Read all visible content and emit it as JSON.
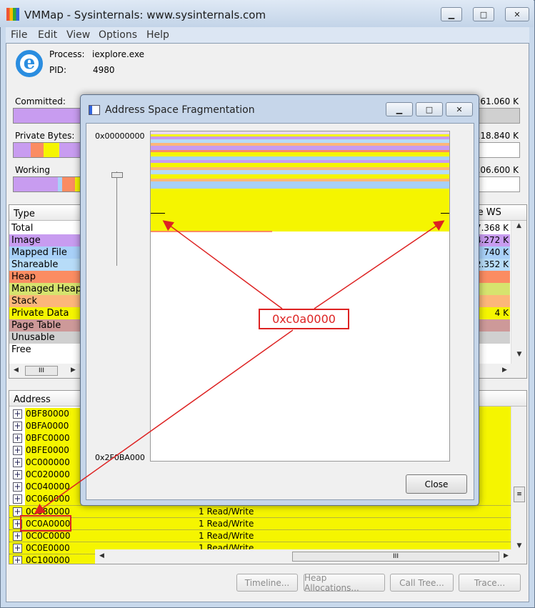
{
  "window": {
    "title": "VMMap - Sysinternals: www.sysinternals.com"
  },
  "menu": [
    "File",
    "Edit",
    "View",
    "Options",
    "Help"
  ],
  "process": {
    "process_label": "Process:",
    "process_value": "iexplore.exe",
    "pid_label": "PID:",
    "pid_value": "4980"
  },
  "summary": {
    "committed": {
      "label": "Committed:",
      "value": "261.060 K"
    },
    "private": {
      "label": "Private Bytes:",
      "value": "118.840 K"
    },
    "working": {
      "label": "Working",
      "value": "106.600 K"
    }
  },
  "type_table": {
    "header_type": "Type",
    "header_ws": "le WS",
    "rows": [
      {
        "type": "Total",
        "color": "#ffffff",
        "ws": "7.368 K"
      },
      {
        "type": "Image",
        "color": "#c89cf0",
        "ws": "4.272 K"
      },
      {
        "type": "Mapped File",
        "color": "#a8d0f8",
        "ws": "740 K"
      },
      {
        "type": "Shareable",
        "color": "#b7dcf8",
        "ws": "2.352 K"
      },
      {
        "type": "Heap",
        "color": "#fb8c62",
        "ws": ""
      },
      {
        "type": "Managed Heap",
        "color": "#d6e36e",
        "ws": ""
      },
      {
        "type": "Stack",
        "color": "#fcb67a",
        "ws": ""
      },
      {
        "type": "Private Data",
        "color": "#f5f500",
        "ws": "4 K"
      },
      {
        "type": "Page Table",
        "color": "#cd9999",
        "ws": ""
      },
      {
        "type": "Unusable",
        "color": "#d0d0d0",
        "ws": ""
      },
      {
        "type": "Free",
        "color": "#ffffff",
        "ws": ""
      }
    ]
  },
  "address_table": {
    "header": "Address",
    "rows": [
      {
        "address": "0BF80000",
        "desc": ""
      },
      {
        "address": "0BFA0000",
        "desc": ""
      },
      {
        "address": "0BFC0000",
        "desc": ""
      },
      {
        "address": "0BFE0000",
        "desc": ""
      },
      {
        "address": "0C000000",
        "desc": ""
      },
      {
        "address": "0C020000",
        "desc": ""
      },
      {
        "address": "0C040000",
        "desc": ""
      },
      {
        "address": "0C060000",
        "desc": ""
      },
      {
        "address": "0C080000",
        "desc": "1 Read/Write"
      },
      {
        "address": "0C0A0000",
        "desc": "1 Read/Write"
      },
      {
        "address": "0C0C0000",
        "desc": "1 Read/Write"
      },
      {
        "address": "0C0E0000",
        "desc": "1 Read/Write"
      },
      {
        "address": "0C100000",
        "desc": ""
      }
    ]
  },
  "buttons": {
    "timeline": "Timeline...",
    "heap": "Heap Allocations...",
    "calltree": "Call Tree...",
    "trace": "Trace..."
  },
  "dialog": {
    "title": "Address Space Fragmentation",
    "addr_top": "0x00000000",
    "addr_bottom": "0x2F0BA000",
    "close": "Close"
  },
  "annotation": {
    "callout": "0xc0a0000"
  },
  "scroll": {
    "thumb_glyph": "III",
    "grip_glyph": "≡"
  },
  "caption": {
    "min": "▁",
    "max": "□",
    "close": "✕"
  }
}
